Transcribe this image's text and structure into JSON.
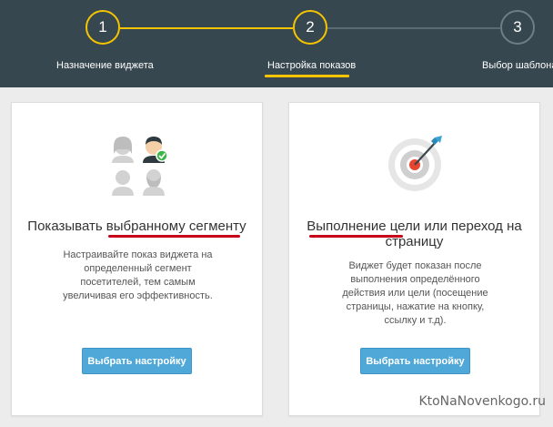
{
  "stepper": {
    "steps": [
      {
        "number": "1",
        "label": "Назначение виджета",
        "state": "done"
      },
      {
        "number": "2",
        "label": "Настройка показов",
        "state": "active"
      },
      {
        "number": "3",
        "label": "Выбор шаблона",
        "state": "pending"
      }
    ]
  },
  "cards": [
    {
      "icon": "users-segment-icon",
      "title": "Показывать выбранному сегменту",
      "description": [
        "Настраивайте показ виджета на",
        "определенный сегмент",
        "посетителей, тем самым",
        "увеличивая его эффективность."
      ],
      "button_label": "Выбрать настройку"
    },
    {
      "icon": "target-icon",
      "title_lines": [
        "Выполнение цели или переход на",
        "страницу"
      ],
      "description": [
        "Виджет будет показан после",
        "выполнения определённого",
        "действия или цели (посещение",
        "страницы, нажатие на кнопку,",
        "ссылку и т.д)."
      ],
      "button_label": "Выбрать настройку"
    }
  ],
  "watermark": "KtoNaNovenkogo.ru",
  "colors": {
    "header_bg": "#37474f",
    "accent": "#f5c400",
    "button": "#4fa8d8",
    "annotation": "#c8001a"
  }
}
